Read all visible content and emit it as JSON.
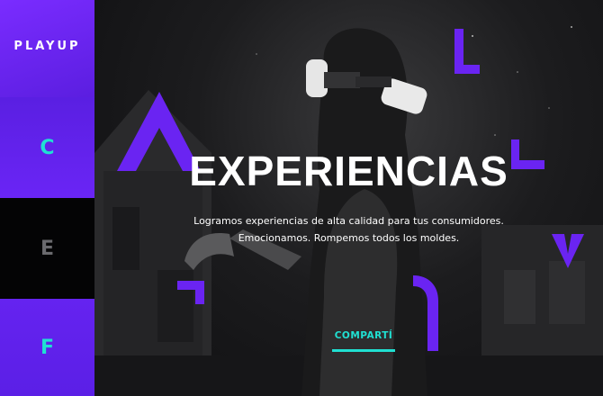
{
  "brand": {
    "logo_text": "PLAYUP"
  },
  "sidebar": {
    "items": [
      {
        "letter": "C"
      },
      {
        "letter": "E"
      },
      {
        "letter": "F"
      }
    ]
  },
  "hero": {
    "headline": "EXPERIENCIAS",
    "tagline_line1": "Logramos experiencias de alta calidad para tus consumidores.",
    "tagline_line2": "Emocionamos. Rompemos todos los moldes.",
    "share_label": "COMPARTÍ"
  },
  "colors": {
    "accent_purple": "#6a24f2",
    "accent_teal": "#20e0d2",
    "background": "#0c0c0e"
  }
}
